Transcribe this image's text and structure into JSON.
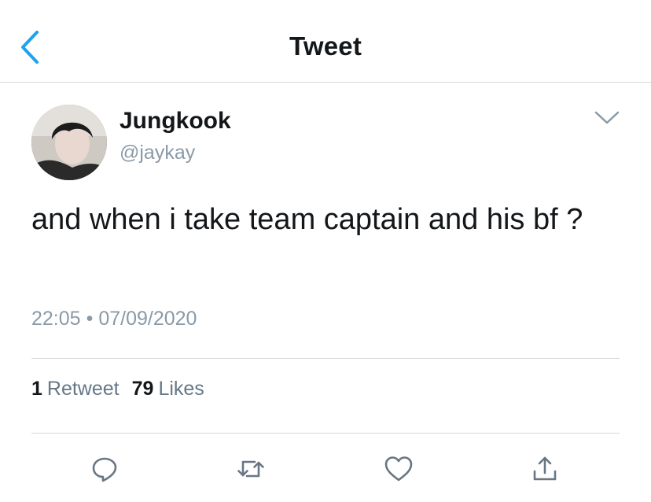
{
  "header": {
    "title": "Tweet"
  },
  "tweet": {
    "display_name": "Jungkook",
    "handle": "@jaykay",
    "text": "and when i take team captain and his bf ?",
    "time": "22:05",
    "separator": "•",
    "date": "07/09/2020"
  },
  "stats": {
    "retweets_count": "1",
    "retweets_label": "Retweet",
    "likes_count": "79",
    "likes_label": "Likes"
  },
  "actions": [
    "reply-icon",
    "retweet-icon",
    "like-icon",
    "share-icon"
  ],
  "colors": {
    "accent": "#1da1f2",
    "muted": "#8a9aa7",
    "icon": "#687684",
    "divider": "#d6d9dc"
  }
}
